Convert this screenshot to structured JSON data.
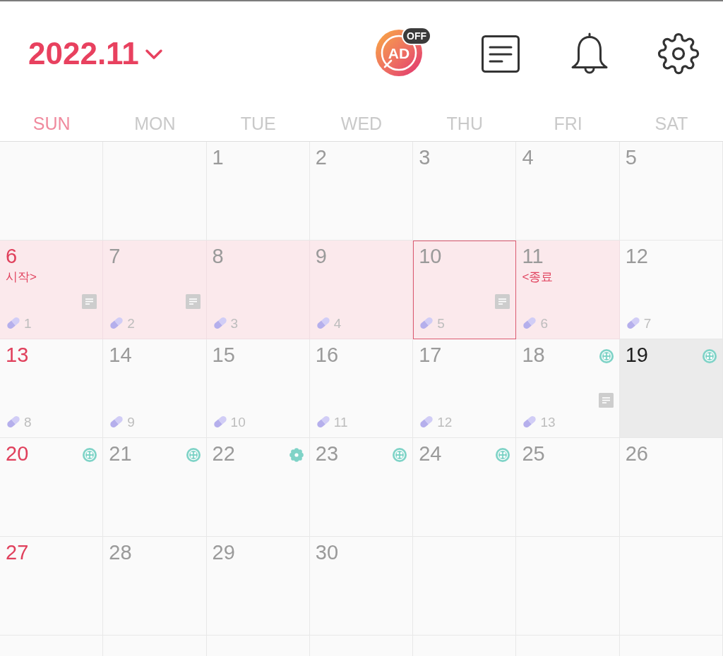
{
  "header": {
    "title": "2022.11",
    "ad_badge": {
      "label": "AD",
      "status": "OFF"
    }
  },
  "weekdays": [
    "SUN",
    "MON",
    "TUE",
    "WED",
    "THU",
    "FRI",
    "SAT"
  ],
  "weeks": [
    {
      "days": [
        {
          "kind": "blank"
        },
        {
          "kind": "blank"
        },
        {
          "kind": "day",
          "date": "1",
          "period": false,
          "outlined": false,
          "selected": false,
          "memo": false
        },
        {
          "kind": "day",
          "date": "2",
          "period": false,
          "outlined": false,
          "selected": false,
          "memo": false
        },
        {
          "kind": "day",
          "date": "3",
          "period": false,
          "outlined": false,
          "selected": false,
          "memo": false
        },
        {
          "kind": "day",
          "date": "4",
          "period": false,
          "outlined": false,
          "selected": false,
          "memo": false
        },
        {
          "kind": "day",
          "date": "5",
          "period": false,
          "outlined": false,
          "selected": false,
          "memo": false
        }
      ]
    },
    {
      "days": [
        {
          "kind": "day",
          "date": "6",
          "period": true,
          "outlined": false,
          "selected": false,
          "note": "시작>",
          "memo": true,
          "pill": "1"
        },
        {
          "kind": "day",
          "date": "7",
          "period": true,
          "outlined": false,
          "selected": false,
          "memo": true,
          "pill": "2"
        },
        {
          "kind": "day",
          "date": "8",
          "period": true,
          "outlined": false,
          "selected": false,
          "memo": false,
          "pill": "3"
        },
        {
          "kind": "day",
          "date": "9",
          "period": true,
          "outlined": false,
          "selected": false,
          "memo": false,
          "pill": "4"
        },
        {
          "kind": "day",
          "date": "10",
          "period": true,
          "outlined": true,
          "selected": false,
          "memo": true,
          "pill": "5"
        },
        {
          "kind": "day",
          "date": "11",
          "period": true,
          "outlined": false,
          "selected": false,
          "note": "<종료",
          "memo": false,
          "pill": "6"
        },
        {
          "kind": "day",
          "date": "12",
          "period": false,
          "outlined": false,
          "selected": false,
          "memo": false,
          "pill": "7"
        }
      ]
    },
    {
      "days": [
        {
          "kind": "day",
          "date": "13",
          "period": false,
          "outlined": false,
          "selected": false,
          "memo": false,
          "pill": "8"
        },
        {
          "kind": "day",
          "date": "14",
          "period": false,
          "outlined": false,
          "selected": false,
          "memo": false,
          "pill": "9"
        },
        {
          "kind": "day",
          "date": "15",
          "period": false,
          "outlined": false,
          "selected": false,
          "memo": false,
          "pill": "10"
        },
        {
          "kind": "day",
          "date": "16",
          "period": false,
          "outlined": false,
          "selected": false,
          "memo": false,
          "pill": "11"
        },
        {
          "kind": "day",
          "date": "17",
          "period": false,
          "outlined": false,
          "selected": false,
          "memo": false,
          "pill": "12"
        },
        {
          "kind": "day",
          "date": "18",
          "period": false,
          "outlined": false,
          "selected": false,
          "memo": true,
          "pill": "13",
          "symbol": {
            "kind": "button"
          }
        },
        {
          "kind": "day",
          "date": "19",
          "period": false,
          "outlined": false,
          "selected": true,
          "memo": false,
          "symbol": {
            "kind": "button"
          }
        }
      ]
    },
    {
      "days": [
        {
          "kind": "day",
          "date": "20",
          "period": false,
          "outlined": false,
          "selected": false,
          "memo": false,
          "symbol": {
            "kind": "button"
          }
        },
        {
          "kind": "day",
          "date": "21",
          "period": false,
          "outlined": false,
          "selected": false,
          "memo": false,
          "symbol": {
            "kind": "button"
          }
        },
        {
          "kind": "day",
          "date": "22",
          "period": false,
          "outlined": false,
          "selected": false,
          "memo": false,
          "symbol": {
            "kind": "flower"
          }
        },
        {
          "kind": "day",
          "date": "23",
          "period": false,
          "outlined": false,
          "selected": false,
          "memo": false,
          "symbol": {
            "kind": "button"
          }
        },
        {
          "kind": "day",
          "date": "24",
          "period": false,
          "outlined": false,
          "selected": false,
          "memo": false,
          "symbol": {
            "kind": "button"
          }
        },
        {
          "kind": "day",
          "date": "25",
          "period": false,
          "outlined": false,
          "selected": false,
          "memo": false
        },
        {
          "kind": "day",
          "date": "26",
          "period": false,
          "outlined": false,
          "selected": false,
          "memo": false
        }
      ]
    },
    {
      "days": [
        {
          "kind": "day",
          "date": "27",
          "period": false,
          "outlined": false,
          "selected": false,
          "memo": false
        },
        {
          "kind": "day",
          "date": "28",
          "period": false,
          "outlined": false,
          "selected": false,
          "memo": false
        },
        {
          "kind": "day",
          "date": "29",
          "period": false,
          "outlined": false,
          "selected": false,
          "memo": false
        },
        {
          "kind": "day",
          "date": "30",
          "period": false,
          "outlined": false,
          "selected": false,
          "memo": false
        },
        {
          "kind": "blank"
        },
        {
          "kind": "blank"
        },
        {
          "kind": "blank"
        }
      ]
    },
    {
      "days": [
        {
          "kind": "blank"
        },
        {
          "kind": "blank"
        },
        {
          "kind": "blank"
        },
        {
          "kind": "blank"
        },
        {
          "kind": "blank"
        },
        {
          "kind": "blank"
        },
        {
          "kind": "blank"
        }
      ]
    }
  ]
}
